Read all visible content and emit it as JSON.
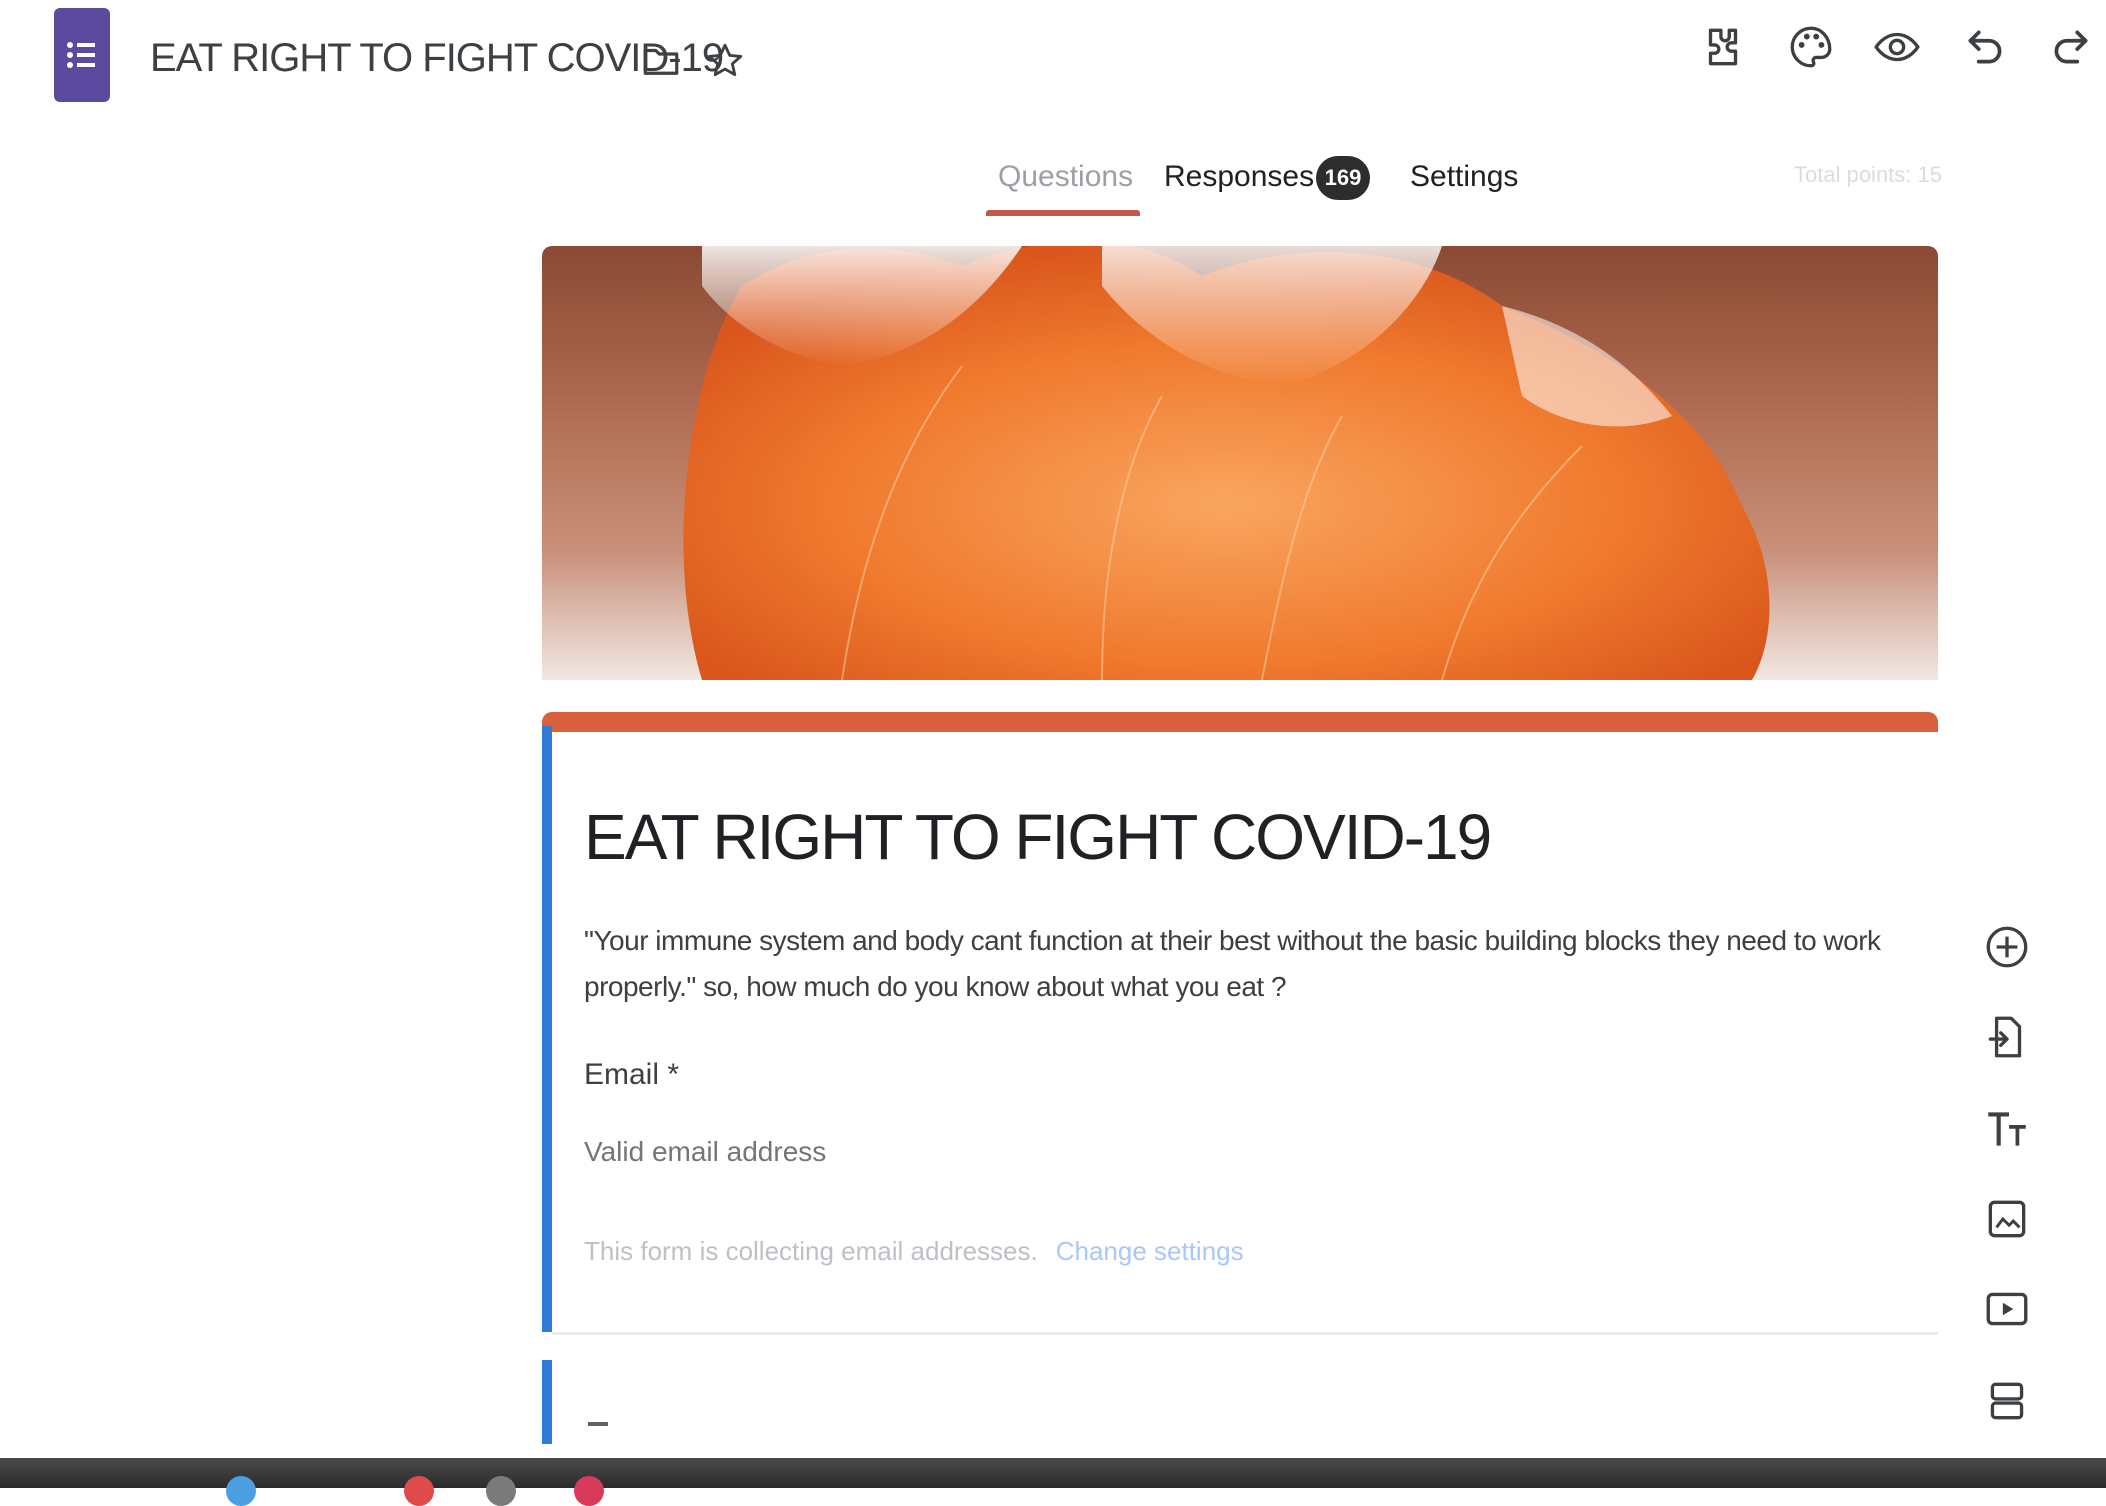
{
  "app": {
    "title": "EAT RIGHT TO FIGHT COVID-19",
    "icons": [
      "forms-app-icon",
      "folder-icon",
      "star-icon",
      "addon-icon",
      "palette-icon",
      "preview-icon",
      "undo-icon",
      "redo-icon"
    ]
  },
  "tabs": {
    "questions": "Questions",
    "responses": "Responses",
    "responses_count": "169",
    "settings": "Settings"
  },
  "total_points": "Total points: 15",
  "form": {
    "title": "EAT RIGHT TO FIGHT COVID-19",
    "description": "\"Your immune system and body cant function at their best without the basic building blocks they need to work properly.\" so, how much do you know about what you eat ?",
    "email_label": "Email *",
    "email_placeholder": "Valid email address",
    "collecting_note": "This form is collecting email addresses.",
    "change_settings": "Change settings"
  },
  "side_toolbar": [
    "add-question-icon",
    "import-questions-icon",
    "add-title-icon",
    "add-image-icon",
    "add-video-icon",
    "add-section-icon"
  ],
  "colors": {
    "brand": "#5b4a9e",
    "accent": "#c0594a",
    "card_top": "#d9603c",
    "focus_bar": "#2f7bd6"
  }
}
